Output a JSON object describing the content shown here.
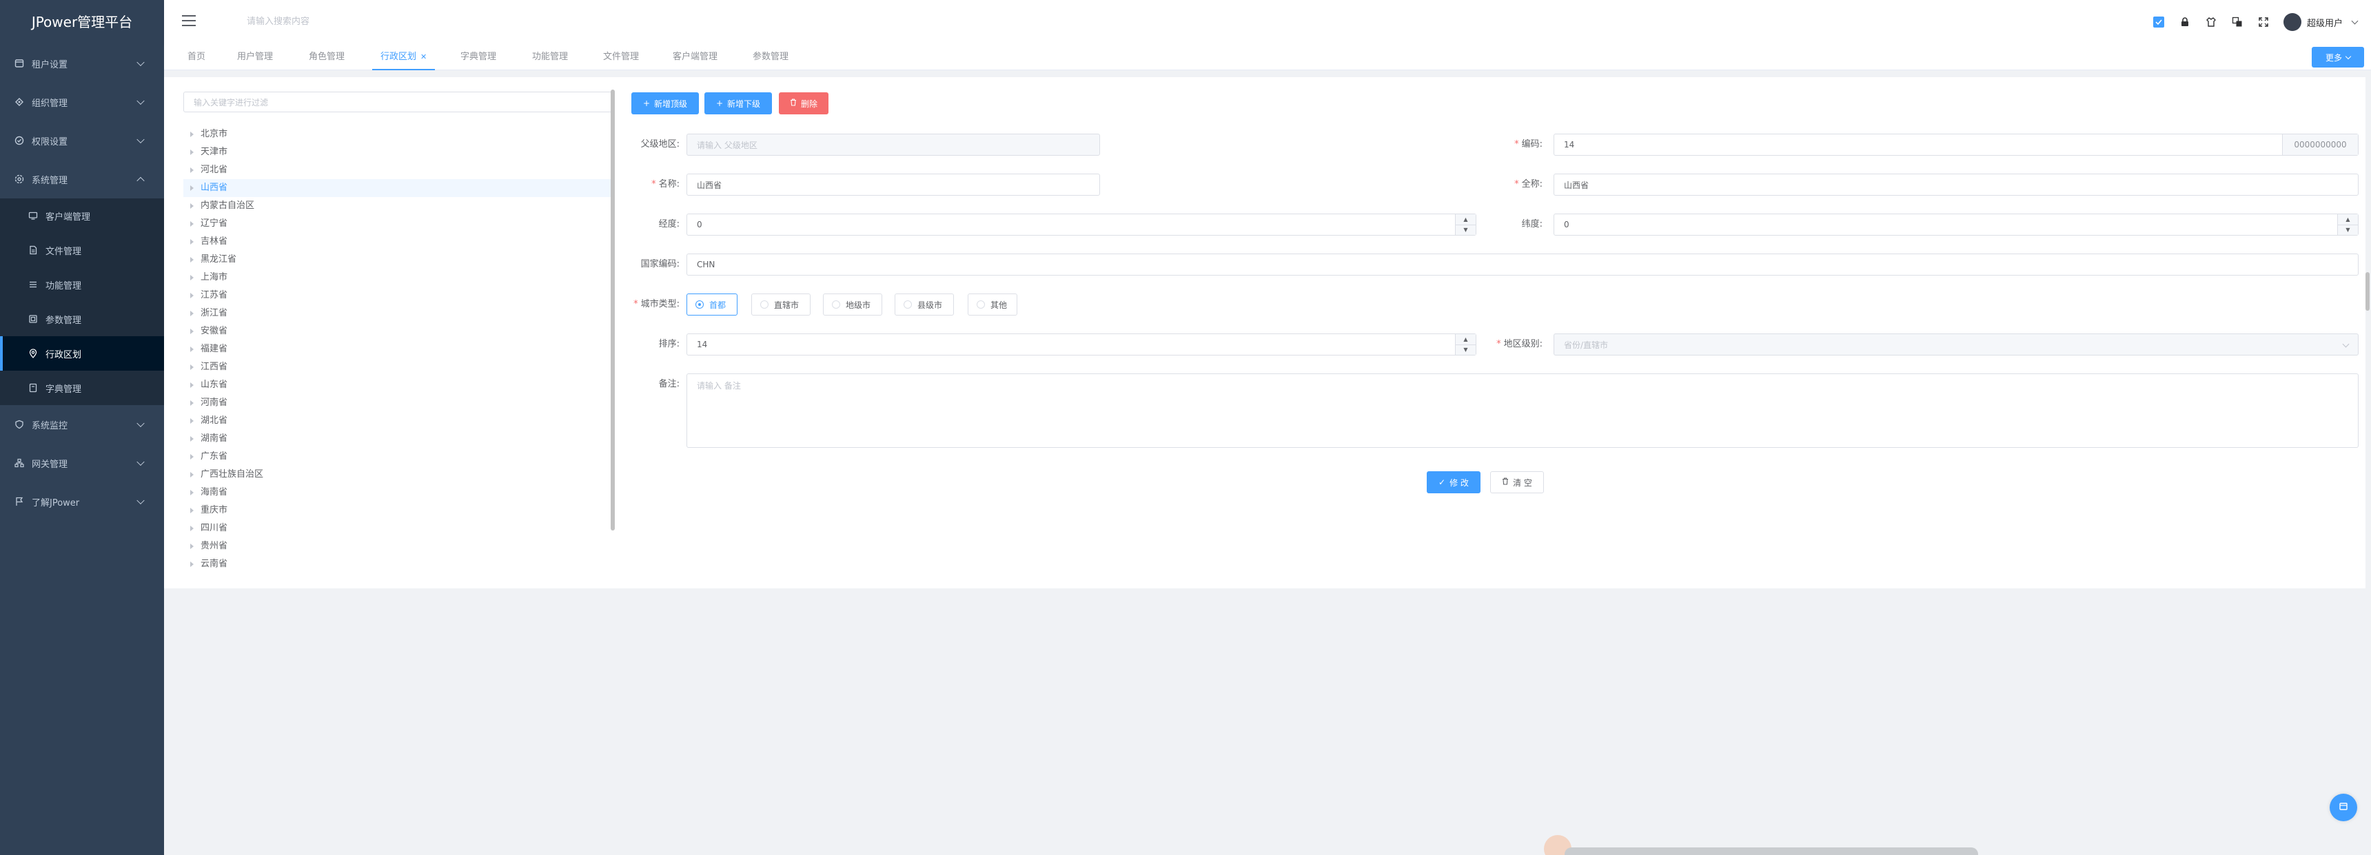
{
  "app": {
    "title": "JPower管理平台"
  },
  "sidebar": {
    "items": [
      {
        "label": "租户设置",
        "icon": "gear-icon"
      },
      {
        "label": "组织管理",
        "icon": "org-icon"
      },
      {
        "label": "权限设置",
        "icon": "shield-icon"
      },
      {
        "label": "系统管理",
        "icon": "gear-icon"
      }
    ],
    "submenu": [
      {
        "label": "客户端管理",
        "icon": "monitor-icon"
      },
      {
        "label": "文件管理",
        "icon": "document-icon"
      },
      {
        "label": "功能管理",
        "icon": "list-icon"
      },
      {
        "label": "参数管理",
        "icon": "param-icon"
      },
      {
        "label": "行政区划",
        "icon": "location-icon"
      },
      {
        "label": "字典管理",
        "icon": "book-icon"
      }
    ],
    "items_after": [
      {
        "label": "系统监控",
        "icon": "monitor-shield-icon"
      },
      {
        "label": "网关管理",
        "icon": "network-icon"
      },
      {
        "label": "了解JPower",
        "icon": "flag-icon"
      }
    ]
  },
  "header": {
    "search_placeholder": "请输入搜索内容",
    "username": "超级用户"
  },
  "tags": [
    {
      "label": "首页"
    },
    {
      "label": "用户管理"
    },
    {
      "label": "角色管理"
    },
    {
      "label": "行政区划",
      "active": true
    },
    {
      "label": "字典管理"
    },
    {
      "label": "功能管理"
    },
    {
      "label": "文件管理"
    },
    {
      "label": "客户端管理"
    },
    {
      "label": "参数管理"
    }
  ],
  "more_label": "更多",
  "tree": {
    "filter_placeholder": "输入关键字进行过滤",
    "nodes": [
      "北京市",
      "天津市",
      "河北省",
      "山西省",
      "内蒙古自治区",
      "辽宁省",
      "吉林省",
      "黑龙江省",
      "上海市",
      "江苏省",
      "浙江省",
      "安徽省",
      "福建省",
      "江西省",
      "山东省",
      "河南省",
      "湖北省",
      "湖南省",
      "广东省",
      "广西壮族自治区",
      "海南省",
      "重庆市",
      "四川省",
      "贵州省",
      "云南省"
    ],
    "selected": "山西省"
  },
  "toolbar": {
    "add_top": "新增顶级",
    "add_child": "新增下级",
    "delete": "删除"
  },
  "form": {
    "parent_label": "父级地区:",
    "parent_placeholder": "请输入 父级地区",
    "code_label": "编码:",
    "code_value": "14",
    "code_suffix": "0000000000",
    "name_label": "名称:",
    "name_value": "山西省",
    "fullname_label": "全称:",
    "fullname_value": "山西省",
    "lng_label": "经度:",
    "lng_value": "0",
    "lat_label": "纬度:",
    "lat_value": "0",
    "country_label": "国家编码:",
    "country_value": "CHN",
    "city_type_label": "城市类型:",
    "city_types": [
      "首都",
      "直辖市",
      "地级市",
      "县级市",
      "其他"
    ],
    "city_type_selected": "首都",
    "sort_label": "排序:",
    "sort_value": "14",
    "level_label": "地区级别:",
    "level_placeholder": "省份/直辖市",
    "remark_label": "备注:",
    "remark_placeholder": "请输入 备注",
    "submit": "修 改",
    "clear": "清 空"
  },
  "colors": {
    "primary": "#409eff",
    "danger": "#f56c6c",
    "sidebar": "#304156"
  }
}
